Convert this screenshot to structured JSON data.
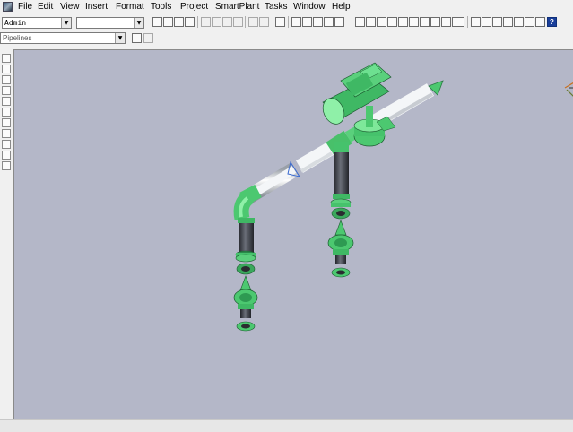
{
  "menu": {
    "items": [
      "File",
      "Edit",
      "View",
      "Insert",
      "Format",
      "Tools",
      "Project",
      "SmartPlant",
      "Tasks",
      "Window",
      "Help"
    ]
  },
  "toolbar": {
    "user_combo": "Admin",
    "second_combo": "",
    "help_icon": "help-icon"
  },
  "row2": {
    "filter_combo": "Pipelines"
  },
  "status": {
    "text": ""
  },
  "colors": {
    "viewport_bg": "#b4b7c8",
    "pipe_green": "#4cc870",
    "pipe_white": "#e8eaec",
    "pipe_dark": "#3a3c44"
  }
}
